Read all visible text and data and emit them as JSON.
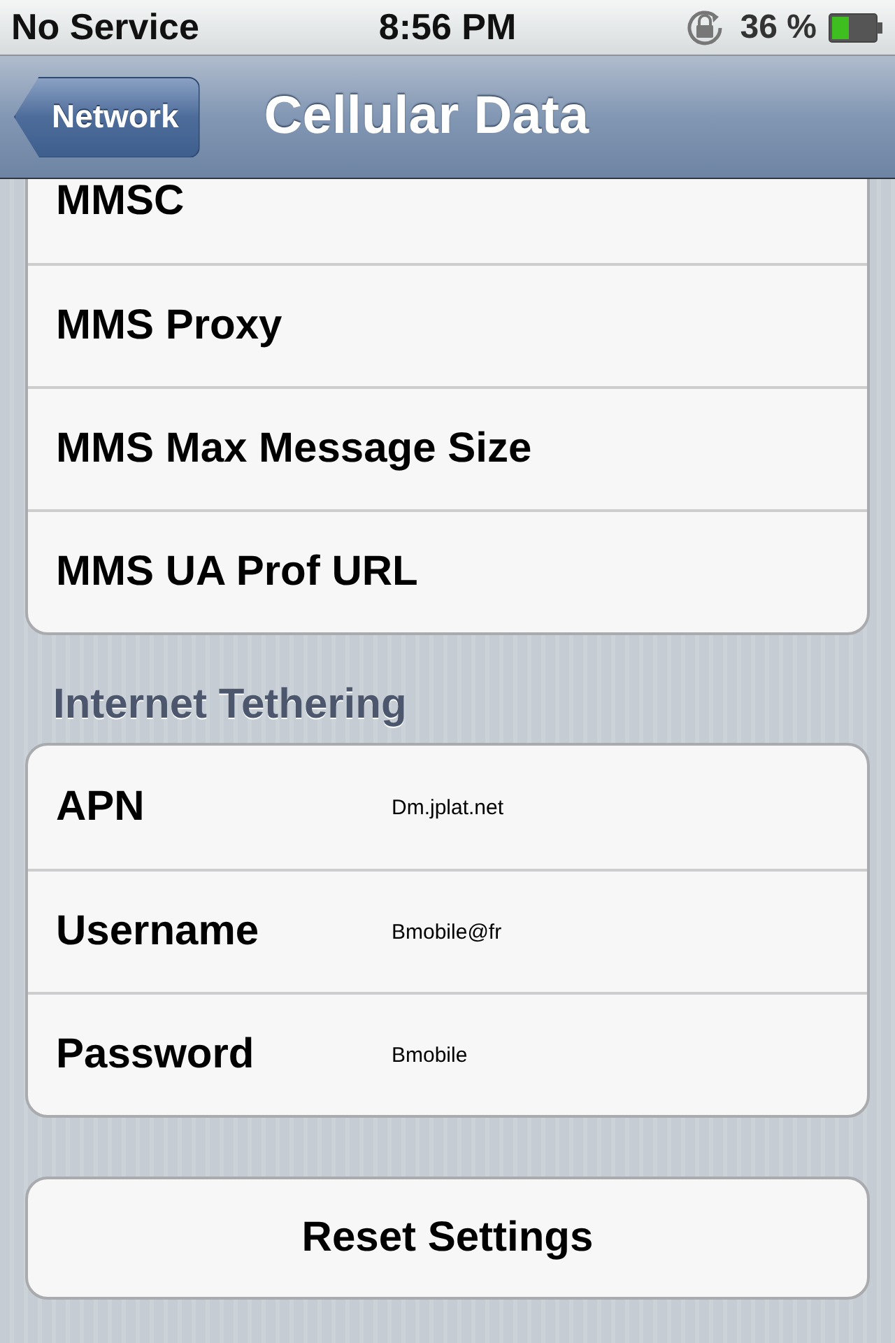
{
  "status_bar": {
    "carrier": "No Service",
    "time": "8:56 PM",
    "battery": "36 %"
  },
  "nav_bar": {
    "back_button": "Network",
    "title": "Cellular Data"
  },
  "mms_group": {
    "rows": [
      {
        "label": "MMSC"
      },
      {
        "label": "MMS Proxy"
      },
      {
        "label": "MMS Max Message Size"
      },
      {
        "label": "MMS UA Prof URL"
      }
    ]
  },
  "tethering_group": {
    "header": "Internet Tethering",
    "rows": [
      {
        "label": "APN",
        "value": "Dm.jplat.net"
      },
      {
        "label": "Username",
        "value": "Bmobile@fr"
      },
      {
        "label": "Password",
        "value": "Bmobile"
      }
    ]
  },
  "reset_button": "Reset Settings"
}
